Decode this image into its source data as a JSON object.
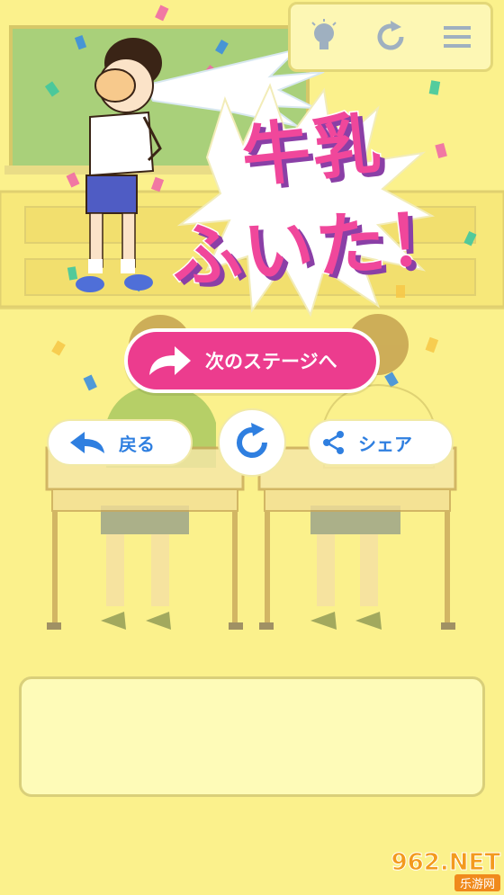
{
  "toolbar": {
    "hint_icon": "lightbulb-icon",
    "reset_icon": "refresh-icon",
    "menu_icon": "hamburger-menu-icon"
  },
  "result": {
    "title_line1": "牛乳",
    "title_line2": "ふいた！"
  },
  "buttons": {
    "next_label": "次のステージへ",
    "back_label": "戻る",
    "share_label": "シェア",
    "retry_icon": "retry-icon"
  },
  "message_box": {
    "text": ""
  },
  "watermark": {
    "top": "962.NET",
    "bottom": "乐游网"
  },
  "colors": {
    "background": "#fbf18c",
    "accent_pink": "#ec3c8e",
    "accent_blue": "#2f7fe0",
    "chalkboard": "#a9d07a"
  }
}
